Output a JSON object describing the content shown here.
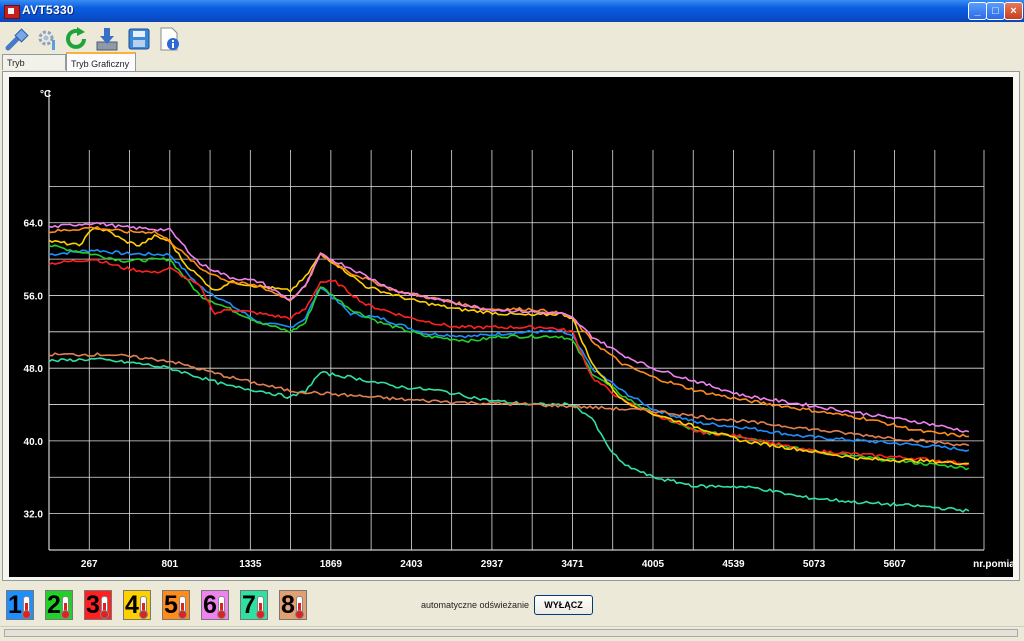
{
  "window": {
    "title": "AVT5330",
    "minimize": "_",
    "maximize": "□",
    "close": "×"
  },
  "toolbar": [
    {
      "icon": "connect-icon"
    },
    {
      "icon": "settings-icon"
    },
    {
      "icon": "refresh-icon"
    },
    {
      "icon": "download-icon"
    },
    {
      "icon": "save-icon"
    },
    {
      "icon": "info-icon"
    }
  ],
  "tabs": [
    {
      "label": "Tryb Tekstowy",
      "active": false
    },
    {
      "label": "Tryb Graficzny",
      "active": true
    }
  ],
  "chart_data": {
    "type": "line",
    "ylabel": "°C",
    "xlabel": "nr.pomiaru",
    "xlim": [
      0,
      6200
    ],
    "ylim": [
      28.0,
      72.0
    ],
    "yticks": [
      "32.0",
      "40.0",
      "48.0",
      "56.0",
      "64.0"
    ],
    "ytick_values": [
      32,
      40,
      48,
      56,
      64
    ],
    "xticks": [
      "267",
      "801",
      "1335",
      "1869",
      "2403",
      "2937",
      "3471",
      "4005",
      "4539",
      "5073",
      "5607"
    ],
    "xtick_values": [
      267,
      801,
      1335,
      1869,
      2403,
      2937,
      3471,
      4005,
      4539,
      5073,
      5607
    ],
    "grid": true,
    "series": [
      {
        "color": "#1e8fff",
        "x": [
          0,
          300,
          500,
          800,
          1000,
          1200,
          1400,
          1600,
          1700,
          1800,
          2000,
          2200,
          2500,
          2800,
          3000,
          3200,
          3400,
          3471,
          3600,
          3800,
          4005,
          4300,
          4600,
          5000,
          5400,
          5800,
          6100
        ],
        "y": [
          60.5,
          61.0,
          60.6,
          60.5,
          57.0,
          55.0,
          53.0,
          52.5,
          53.5,
          57.0,
          54.0,
          53.5,
          51.8,
          51.5,
          51.8,
          52.0,
          52.0,
          51.5,
          48.0,
          45.5,
          43.5,
          42.0,
          41.5,
          40.5,
          40.0,
          39.5,
          39.0
        ]
      },
      {
        "color": "#22d028",
        "x": [
          0,
          300,
          500,
          800,
          1000,
          1200,
          1400,
          1600,
          1700,
          1800,
          2000,
          2200,
          2500,
          2800,
          3000,
          3200,
          3400,
          3471,
          3600,
          3800,
          4005,
          4300,
          4600,
          5000,
          5400,
          5800,
          6100
        ],
        "y": [
          61.5,
          60.5,
          59.8,
          60.0,
          56.0,
          54.5,
          53.0,
          52.0,
          53.0,
          57.0,
          54.5,
          53.0,
          51.5,
          51.0,
          51.5,
          51.5,
          51.5,
          51.0,
          47.5,
          45.0,
          43.0,
          41.0,
          40.5,
          39.0,
          38.2,
          37.5,
          37.0
        ]
      },
      {
        "color": "#ff2020",
        "x": [
          0,
          300,
          500,
          700,
          800,
          1000,
          1100,
          1200,
          1400,
          1600,
          1700,
          1800,
          1900,
          2100,
          2400,
          2700,
          3000,
          3300,
          3471,
          3600,
          3800,
          4005,
          4300,
          4600,
          5000,
          5400,
          5800,
          6100
        ],
        "y": [
          59.5,
          60.0,
          59.0,
          58.5,
          59.0,
          57.0,
          54.0,
          54.5,
          54.0,
          53.5,
          54.5,
          57.5,
          57.5,
          55.0,
          53.5,
          52.5,
          52.5,
          52.5,
          52.0,
          47.0,
          44.5,
          43.0,
          41.0,
          40.5,
          39.0,
          38.5,
          38.0,
          37.5
        ]
      },
      {
        "color": "#ffd000",
        "x": [
          0,
          200,
          300,
          400,
          500,
          600,
          700,
          800,
          900,
          1000,
          1100,
          1200,
          1400,
          1600,
          1700,
          1800,
          1900,
          2100,
          2400,
          2700,
          3000,
          3200,
          3400,
          3471,
          3600,
          3800,
          4005,
          4300,
          4600,
          5000,
          5400,
          5800,
          6100
        ],
        "y": [
          62.0,
          61.5,
          63.5,
          63.0,
          62.0,
          61.5,
          62.5,
          62.0,
          59.5,
          58.0,
          56.5,
          57.5,
          57.0,
          56.5,
          58.0,
          60.5,
          59.5,
          57.0,
          55.5,
          54.5,
          54.0,
          53.8,
          54.0,
          53.5,
          48.5,
          44.5,
          43.0,
          41.5,
          40.0,
          39.0,
          38.0,
          37.8,
          37.5
        ]
      },
      {
        "color": "#ff8c1a",
        "x": [
          0,
          300,
          500,
          700,
          800,
          1000,
          1200,
          1400,
          1600,
          1700,
          1800,
          2000,
          2300,
          2600,
          2900,
          3200,
          3400,
          3471,
          3600,
          3800,
          4005,
          4300,
          4600,
          5000,
          5400,
          5800,
          6100
        ],
        "y": [
          63.0,
          63.5,
          63.0,
          63.0,
          62.0,
          59.0,
          57.5,
          57.0,
          55.5,
          57.0,
          60.5,
          58.5,
          56.5,
          55.5,
          54.5,
          54.5,
          54.0,
          53.5,
          51.0,
          48.5,
          47.0,
          45.5,
          44.5,
          43.5,
          42.5,
          41.0,
          40.5
        ]
      },
      {
        "color": "#ee82ee",
        "x": [
          0,
          300,
          500,
          800,
          1000,
          1200,
          1400,
          1600,
          1700,
          1800,
          2000,
          2300,
          2600,
          2900,
          3200,
          3400,
          3471,
          3600,
          3800,
          4005,
          4300,
          4600,
          5000,
          5400,
          5800,
          6100
        ],
        "y": [
          63.5,
          64.0,
          63.5,
          63.2,
          59.5,
          58.0,
          57.5,
          55.5,
          57.0,
          60.5,
          59.0,
          56.5,
          55.5,
          54.5,
          54.2,
          54.0,
          53.5,
          51.5,
          49.5,
          48.0,
          46.5,
          45.0,
          44.0,
          43.0,
          42.0,
          41.0
        ]
      },
      {
        "color": "#30e0a0",
        "x": [
          0,
          300,
          600,
          800,
          1000,
          1200,
          1400,
          1600,
          1700,
          1800,
          2000,
          2300,
          2600,
          2900,
          3200,
          3400,
          3471,
          3600,
          3700,
          3800,
          4005,
          4300,
          4539,
          4700,
          5000,
          5400,
          5800,
          6100
        ],
        "y": [
          48.8,
          49.0,
          48.5,
          48.0,
          47.0,
          46.0,
          45.5,
          44.8,
          45.5,
          47.5,
          47.0,
          46.0,
          45.5,
          44.5,
          44.0,
          44.0,
          44.0,
          42.5,
          39.5,
          37.5,
          36.0,
          35.0,
          35.0,
          34.8,
          33.8,
          33.2,
          32.8,
          32.3
        ]
      },
      {
        "color": "#e08050",
        "x": [
          0,
          400,
          800,
          1200,
          1600,
          2000,
          2400,
          2800,
          3200,
          3471,
          3800,
          4005,
          4400,
          4800,
          5200,
          5600,
          6100
        ],
        "y": [
          49.5,
          49.5,
          48.8,
          47.0,
          45.5,
          45.0,
          44.5,
          44.2,
          44.0,
          43.8,
          43.5,
          43.3,
          42.5,
          41.8,
          41.0,
          40.3,
          39.5
        ]
      }
    ]
  },
  "channels": [
    {
      "num": "1",
      "color": "#1e8fff"
    },
    {
      "num": "2",
      "color": "#22d028"
    },
    {
      "num": "3",
      "color": "#ff2020"
    },
    {
      "num": "4",
      "color": "#ffd000"
    },
    {
      "num": "5",
      "color": "#ff8c1a"
    },
    {
      "num": "6",
      "color": "#ee82ee"
    },
    {
      "num": "7",
      "color": "#30e0a0"
    },
    {
      "num": "8",
      "color": "#e0a070"
    }
  ],
  "controls": {
    "auto_refresh_label": "automatyczne odświeżanie",
    "off_button": "WYŁĄCZ"
  }
}
